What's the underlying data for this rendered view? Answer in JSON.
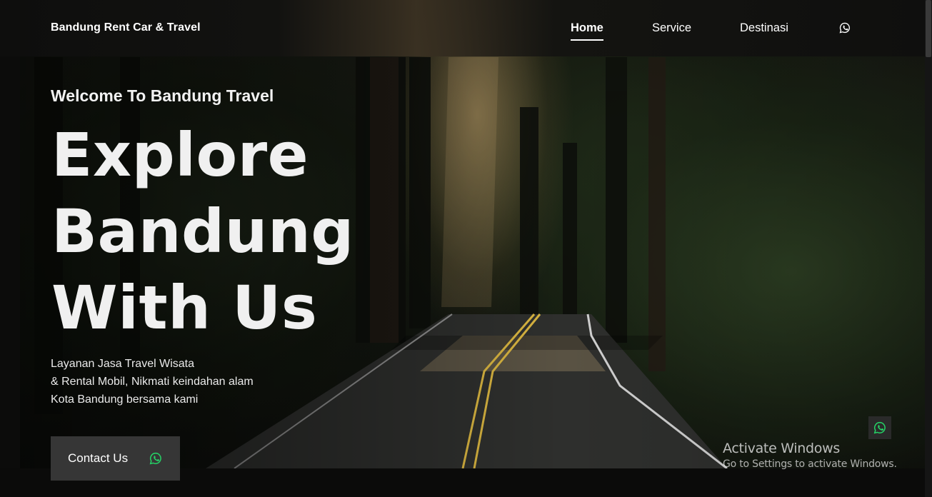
{
  "navbar": {
    "brand": "Bandung Rent Car & Travel",
    "links": [
      {
        "label": "Home",
        "active": true
      },
      {
        "label": "Service",
        "active": false
      },
      {
        "label": "Destinasi",
        "active": false
      }
    ],
    "whatsapp_icon": "whatsapp-icon"
  },
  "hero": {
    "welcome": "Welcome To Bandung Travel",
    "headline_lines": [
      "Explore",
      "Bandung",
      "With Us"
    ],
    "description_lines": [
      "Layanan Jasa Travel Wisata",
      "& Rental Mobil, Nikmati keindahan alam",
      "Kota Bandung bersama kami"
    ],
    "cta_label": "Contact Us",
    "cta_icon": "whatsapp-icon",
    "background": "forest road with sun ray"
  },
  "floating_button": {
    "icon": "whatsapp-icon"
  },
  "os_watermark": {
    "title": "Activate Windows",
    "subtitle": "Go to Settings to activate Windows."
  },
  "colors": {
    "accent_whatsapp": "#25D366",
    "button_bg": "#363636",
    "text": "#ffffff"
  }
}
